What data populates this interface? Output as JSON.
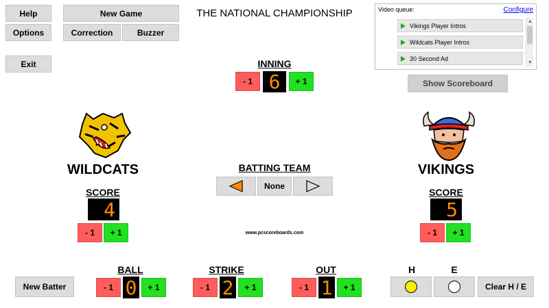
{
  "title": "THE NATIONAL CHAMPIONSHIP",
  "toolbar": {
    "help": "Help",
    "options": "Options",
    "exit": "Exit",
    "new_game": "New Game",
    "correction": "Correction",
    "buzzer": "Buzzer"
  },
  "video_queue": {
    "label": "Video queue:",
    "configure": "Configure",
    "items": [
      "Vikings Player Intros",
      "Wildcats Player Intros",
      "30 Second Ad"
    ]
  },
  "show_scoreboard": "Show Scoreboard",
  "inning": {
    "label": "INNING",
    "value": "6",
    "minus": "- 1",
    "plus": "+ 1"
  },
  "home": {
    "name": "WILDCATS",
    "score_label": "SCORE",
    "score": "4",
    "minus": "- 1",
    "plus": "+ 1"
  },
  "away": {
    "name": "VIKINGS",
    "score_label": "SCORE",
    "score": "5",
    "minus": "- 1",
    "plus": "+ 1"
  },
  "batting": {
    "label": "BATTING TEAM",
    "value": "None"
  },
  "website": "www.pcscoreboards.com",
  "new_batter": "New Batter",
  "ball": {
    "label": "BALL",
    "value": "0",
    "minus": "- 1",
    "plus": "+ 1"
  },
  "strike": {
    "label": "STRIKE",
    "value": "2",
    "minus": "- 1",
    "plus": "+ 1"
  },
  "out": {
    "label": "OUT",
    "value": "1",
    "minus": "- 1",
    "plus": "+ 1"
  },
  "hit": {
    "label": "H"
  },
  "error": {
    "label": "E"
  },
  "clear_he": "Clear H / E",
  "colors": {
    "digit": "#ff8c00",
    "minus": "#ff5c5c",
    "plus": "#22e022",
    "hit_on": "#ffee00",
    "arrow": "#ff8c00"
  }
}
